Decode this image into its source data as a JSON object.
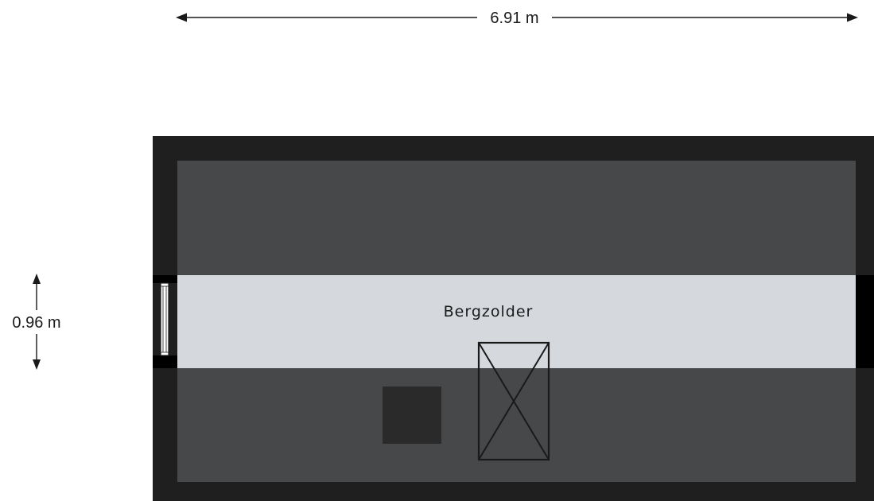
{
  "plan": {
    "room_name": "Bergzolder",
    "width_label": "6.91 m",
    "height_label": "0.96 m"
  },
  "colors": {
    "wall": "#1f1f1f",
    "sloped_ceiling": "#474849",
    "floor_headroom": "#d5d8dc",
    "stairs": "#2a2a2a"
  }
}
